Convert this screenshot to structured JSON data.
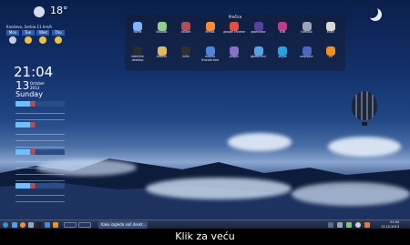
{
  "weather": {
    "temperature": "18°",
    "location": "Kneževo, Serbia 11 km/h",
    "days": [
      {
        "label": "Mon"
      },
      {
        "label": "Tue"
      },
      {
        "label": "Wed"
      },
      {
        "label": "Thu"
      }
    ]
  },
  "clock": {
    "time": "21:04",
    "day_number": "13",
    "month": "October",
    "year": "2013",
    "weekday": "Sunday"
  },
  "launcher": {
    "title": "Prečice",
    "apps": [
      {
        "label": "home",
        "color": "#7fb7ff"
      },
      {
        "label": "baobab",
        "color": "#8fd08a"
      },
      {
        "label": "calibre",
        "color": "#b05050"
      },
      {
        "label": "firefox",
        "color": "#ff8a30"
      },
      {
        "label": "google chrome",
        "color": "#e74c3c"
      },
      {
        "label": "gwenview",
        "color": "#5b3fa0"
      },
      {
        "label": "k3b",
        "color": "#c03a8a"
      },
      {
        "label": "kamoso",
        "color": "#9aa4b5"
      },
      {
        "label": "kcalc",
        "color": "#d8d8d8"
      },
      {
        "label": "kdenlive desktop",
        "color": "#2b2b2b"
      },
      {
        "label": "kdesvn",
        "color": "#e0b860"
      },
      {
        "label": "krita",
        "color": "#2f2f2f"
      },
      {
        "label": "mozilla thunderbird",
        "color": "#4d86d9"
      },
      {
        "label": "pidgin",
        "color": "#8a6fc7"
      },
      {
        "label": "qbittorrent",
        "color": "#5aa0e8"
      },
      {
        "label": "skype",
        "color": "#22a3e6"
      },
      {
        "label": "smplayer",
        "color": "#4a69c2"
      },
      {
        "label": "vlc",
        "color": "#f2901d"
      }
    ]
  },
  "taskbar": {
    "task_label": "Kako izgleda vaš deskt...",
    "time": "21:04",
    "date": "13.10.2013"
  },
  "caption": "Klik za veću"
}
